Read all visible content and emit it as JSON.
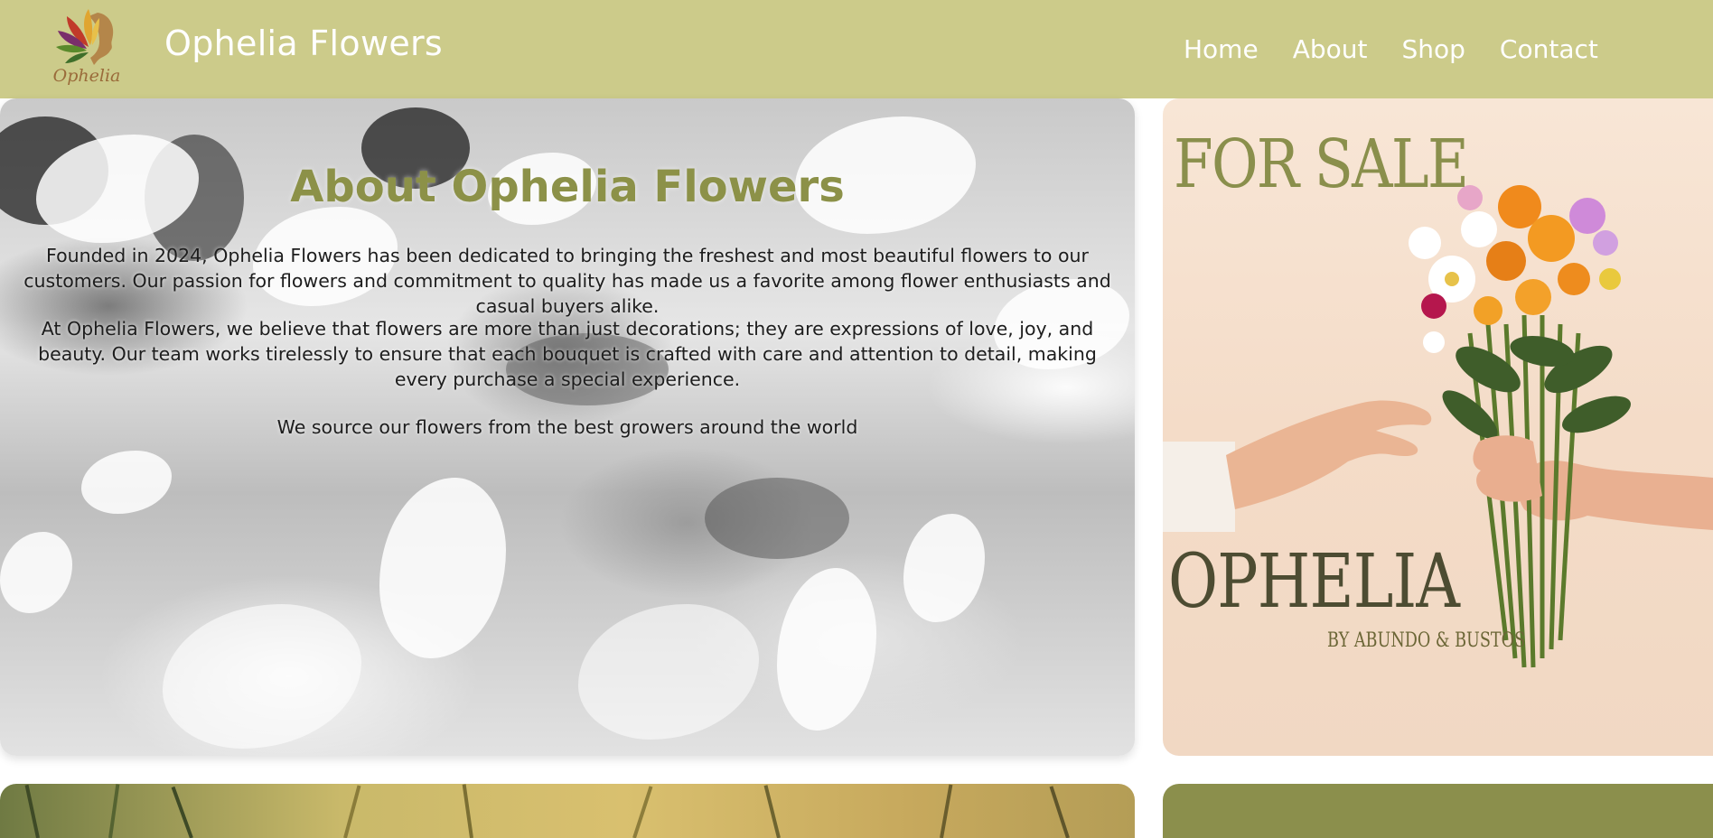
{
  "header": {
    "logo_text": "Ophelia",
    "brand_title": "Ophelia Flowers",
    "nav": [
      {
        "label": "Home"
      },
      {
        "label": "About"
      },
      {
        "label": "Shop"
      },
      {
        "label": "Contact"
      }
    ]
  },
  "about": {
    "heading": "About Ophelia Flowers",
    "paragraphs": [
      "Founded in 2024, Ophelia Flowers has been dedicated to bringing the freshest and most beautiful flowers to our customers. Our passion for flowers and commitment to quality has made us a favorite among flower enthusiasts and casual buyers alike.",
      "At Ophelia Flowers, we believe that flowers are more than just decorations; they are expressions of love, joy, and beauty. Our team works tirelessly to ensure that each bouquet is crafted with care and attention to detail, making every purchase a special experience.",
      "We source our flowers from the best growers around the world"
    ]
  },
  "sale_poster": {
    "title": "FOR SALE",
    "brand": "OPHELIA",
    "byline": "BY ABUNDO & BUSTOS"
  },
  "colors": {
    "header_bg": "#cccb8a",
    "heading_olive": "#8c9148",
    "bottom_right_panel": "#8b8f4c"
  }
}
